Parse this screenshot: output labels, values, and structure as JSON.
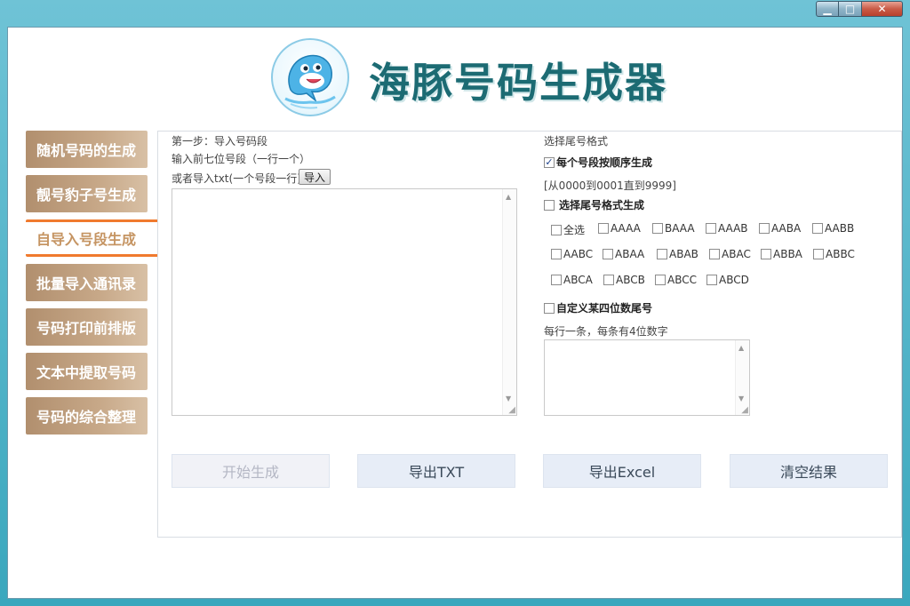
{
  "window": {
    "minimize_label": "▁",
    "maximize_label": "□",
    "close_label": "✕"
  },
  "header": {
    "app_title": "海豚号码生成器"
  },
  "sidebar": {
    "items": [
      {
        "label": "随机号码的生成"
      },
      {
        "label": "靓号豹子号生成"
      },
      {
        "label": "自导入号段生成"
      },
      {
        "label": "批量导入通讯录"
      },
      {
        "label": "号码打印前排版"
      },
      {
        "label": "文本中提取号码"
      },
      {
        "label": "号码的综合整理"
      }
    ]
  },
  "left": {
    "step_label": "第一步：导入号码段",
    "input_hint": "输入前七位号段（一行一个）",
    "import_hint": "或者导入txt(一个号段一行)",
    "import_button": "导入",
    "textarea_value": ""
  },
  "right": {
    "select_format_label": "选择尾号格式",
    "sequential_label": "每个号段按顺序生成",
    "sequential_checked": true,
    "range_note": "[从0000到0001直到9999]",
    "select_format_generate_label": "选择尾号格式生成",
    "formats_row1": [
      "全选",
      "AAAA",
      "BAAA",
      "AAAB",
      "AABA",
      "AABB"
    ],
    "formats_row2": [
      "AABC",
      "ABAA",
      "ABAB",
      "ABAC",
      "ABBA",
      "ABBC"
    ],
    "formats_row3": [
      "ABCA",
      "ABCB",
      "ABCC",
      "ABCD"
    ],
    "custom_label": "自定义某四位数尾号",
    "custom_hint": "每行一条，每条有4位数字",
    "custom_value": ""
  },
  "actions": {
    "start": "开始生成",
    "export_txt": "导出TXT",
    "export_excel": "导出Excel",
    "clear": "清空结果"
  },
  "colors": {
    "accent_orange": "#f07a2e",
    "nav_brown": "#b18f6e",
    "title_teal": "#1c6b73"
  }
}
